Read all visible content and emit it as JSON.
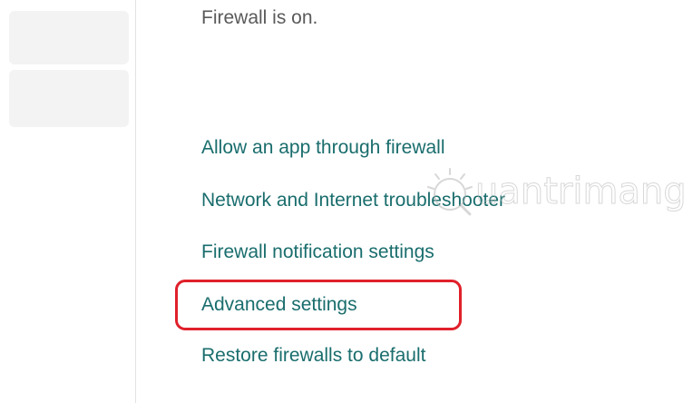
{
  "firewall": {
    "status": "Firewall is on."
  },
  "links": [
    {
      "label": "Allow an app through firewall"
    },
    {
      "label": "Network and Internet troubleshooter"
    },
    {
      "label": "Firewall notification settings"
    },
    {
      "label": "Advanced settings",
      "highlighted": true
    },
    {
      "label": "Restore firewalls to default"
    }
  ],
  "watermark": {
    "text": "uantrimang"
  },
  "colors": {
    "link": "#1a6d6d",
    "status_text": "#5a5a5a",
    "highlight_border": "#e0202a",
    "sidebar_card": "#f3f3f3"
  }
}
